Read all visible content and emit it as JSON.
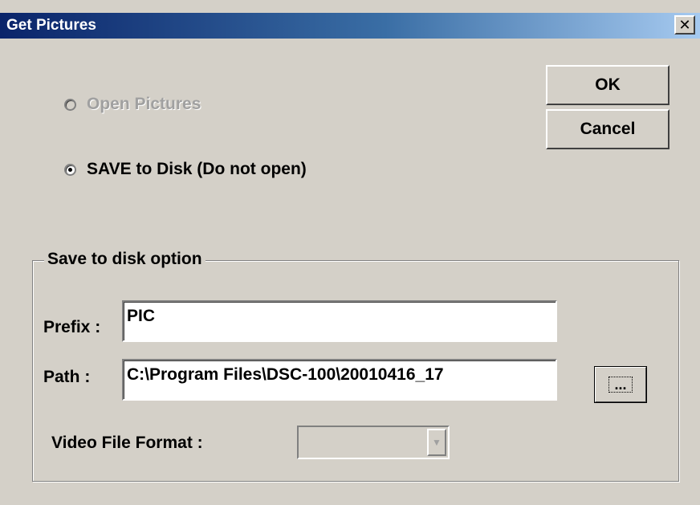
{
  "window": {
    "title": "Get Pictures",
    "close_glyph": "✕"
  },
  "options": {
    "open_pictures": {
      "label": "Open Pictures",
      "checked": false,
      "enabled": false
    },
    "save_to_disk": {
      "label": "SAVE to Disk (Do not open)",
      "checked": true,
      "enabled": true
    }
  },
  "buttons": {
    "ok": "OK",
    "cancel": "Cancel",
    "browse": "..."
  },
  "save_group": {
    "legend": "Save to disk option",
    "prefix_label": "Prefix :",
    "prefix_value": "PIC",
    "path_label": "Path :",
    "path_value": "C:\\Program Files\\DSC-100\\20010416_17",
    "video_format_label": "Video File Format :",
    "video_format_value": "",
    "combo_arrow_glyph": "▼"
  },
  "icons": {
    "close": "close-icon",
    "dropdown": "chevron-down-icon"
  }
}
